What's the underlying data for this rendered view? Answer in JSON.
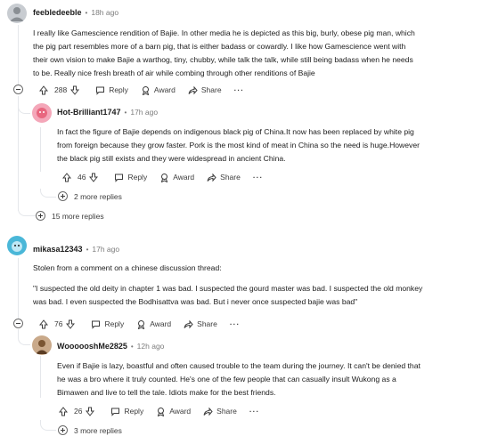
{
  "comments": [
    {
      "author": "feebledeeble",
      "time": "18h ago",
      "lines": [
        "I really like Gamescience rendition of Bajie. In other media he is depicted as this big, burly, obese pig man, which",
        "the pig part resembles more of a barn pig, that is either badass or cowardly. I like how Gamescience went with",
        "their own vision to make Bajie a warthog, tiny, chubby, while talk the talk, while still being badass when he needs",
        "to be. Really nice fresh breath of air while combing through other renditions of Bajie"
      ],
      "score": "288",
      "more_replies": "15 more replies"
    },
    {
      "author": "Hot-Brilliant1747",
      "time": "17h ago",
      "lines": [
        "In fact the figure of Bajie depends on indigenous black pig of China.It now has been replaced by white pig",
        "from foreign because they grow faster. Pork is the most kind of meat in China so the need is huge.However",
        "the black pig still exists and they were widespread in ancient China."
      ],
      "score": "46",
      "more_replies": "2 more replies"
    },
    {
      "author": "mikasa12343",
      "time": "17h ago",
      "intro": "Stolen from a comment on a chinese discussion thread:",
      "lines": [
        "\"I suspected the old deity in chapter 1 was bad. I suspected the gourd master was bad. I suspected the old monkey",
        "was bad. I even suspected the Bodhisattva was bad. But i never once suspected bajie was bad\""
      ],
      "score": "76"
    },
    {
      "author": "WoooooshMe2825",
      "time": "12h ago",
      "lines": [
        "Even if Bajie is lazy, boastful and often caused trouble to the team during the journey. It can't be denied that",
        "he was a bro where it truly counted. He's one of the few people that can casually insult Wukong as a",
        "Bimawen and live to tell the tale. Idiots make for the best friends."
      ],
      "score": "26",
      "more_replies": "3 more replies"
    }
  ],
  "actions": {
    "reply": "Reply",
    "award": "Award",
    "share": "Share",
    "more": "···"
  },
  "colors": {
    "avatar1": "#c8ccd1",
    "avatar2": "#f4a7b9",
    "avatar3": "#4ab7d8",
    "avatar4": "#c9a98a"
  }
}
